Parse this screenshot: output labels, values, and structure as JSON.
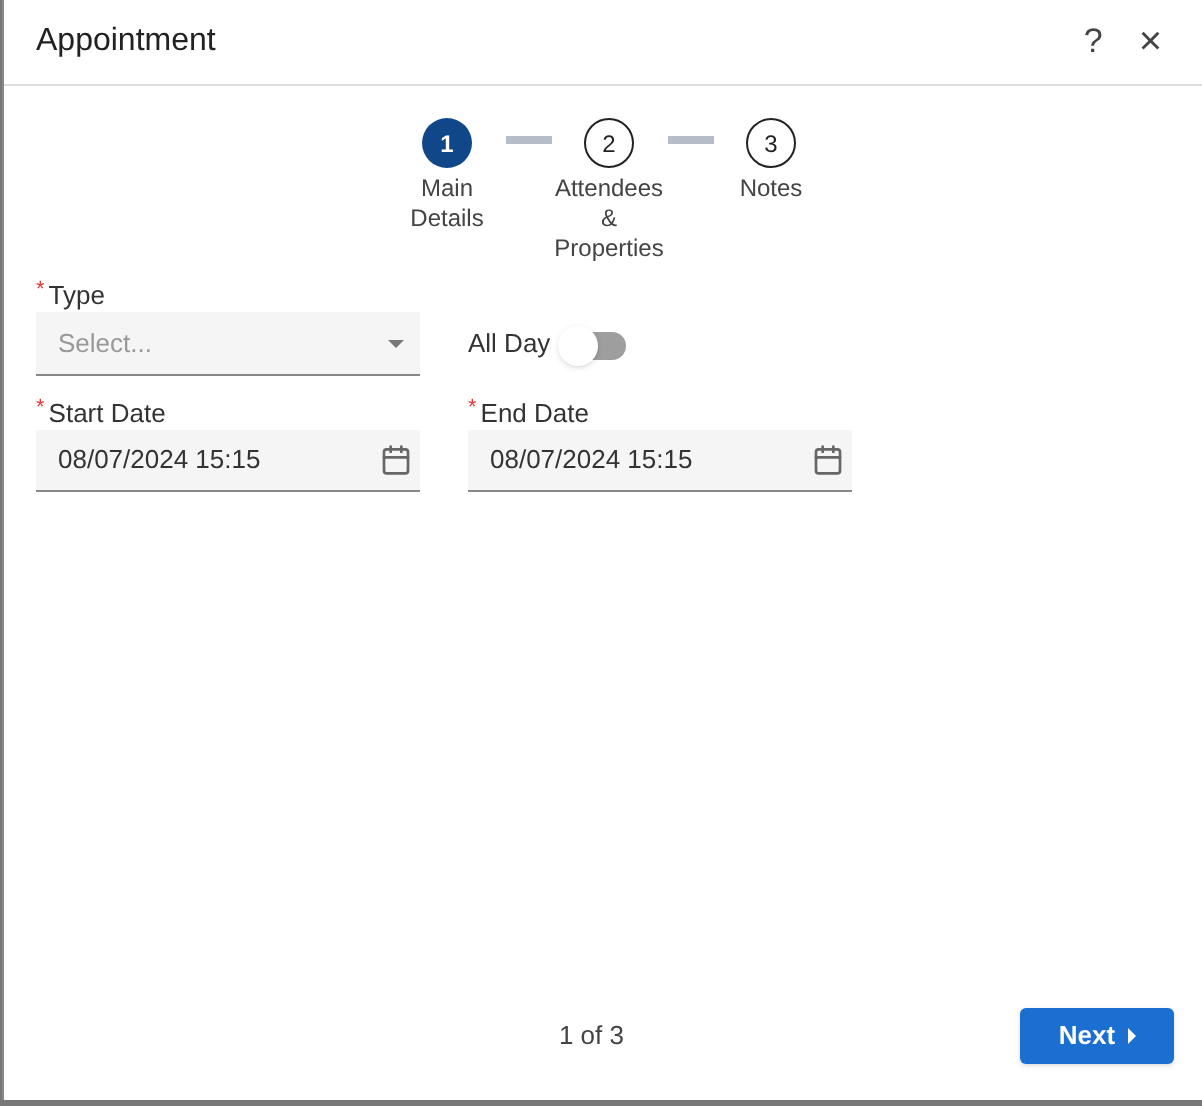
{
  "window": {
    "title": "Appointment",
    "help": "?",
    "close": "×"
  },
  "steps": [
    {
      "number": "1",
      "label": "Main Details",
      "selected": true
    },
    {
      "number": "2",
      "label": "Attendees & Properties",
      "selected": false
    },
    {
      "number": "3",
      "label": "Notes",
      "selected": false
    }
  ],
  "type_field": {
    "label": "Type",
    "required_mark": "*",
    "placeholder": "Select..."
  },
  "all_day": {
    "label": "All Day",
    "on": false
  },
  "start_date": {
    "label": "Start Date",
    "required_mark": "*",
    "value": "08/07/2024 15:15"
  },
  "end_date": {
    "label": "End Date",
    "required_mark": "*",
    "value": "08/07/2024 15:15"
  },
  "footer": {
    "page": "1 of 3",
    "next": "Next"
  }
}
